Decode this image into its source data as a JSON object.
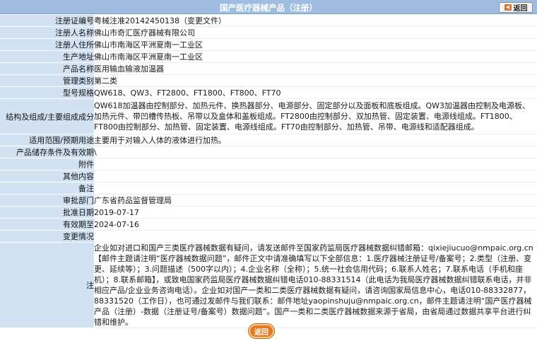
{
  "header": {
    "title": "国产医疗器械产品（注册）",
    "back_label": "返回"
  },
  "rows": [
    {
      "label": "注册证编号",
      "value": "粤械注准20142450138（变更文件）"
    },
    {
      "label": "注册人名称",
      "value": "佛山市奇汇医疗器械有限公司"
    },
    {
      "label": "注册人住所",
      "value": "佛山市南海区平洲夏南一工业区"
    },
    {
      "label": "生产地址",
      "value": "佛山市南海区平洲夏南一工业区"
    },
    {
      "label": "产品名称",
      "value": "医用输血输液加温器"
    },
    {
      "label": "管理类别",
      "value": "第二类"
    },
    {
      "label": "型号规格",
      "value": "QW618、QW3、FT2800、FT1800、FT800、FT70"
    },
    {
      "label": "结构及组成/主要组成成分",
      "value": "QW618加温器由控制部分、加热元件、换热器部分、电源部分、固定部分以及面板和底板组成。QW3加温器由控制及电源板、加热元件、带凹槽传热板、吊带以及盒体和盖板组成。FT2800由控制部分、双加热管、固定装置、电源线组成。FT1800、FT800由控制部分、加热管、固定装置、电源线组成。FT70由控制部分、加热管、吊带、电源线和适配器组成。"
    },
    {
      "label": "适用范围/预期用途",
      "value": "主要用于对输入人体的液体进行加热。"
    },
    {
      "label": "产品储存条件及有效期",
      "value": "\\"
    },
    {
      "label": "附件",
      "value": ""
    },
    {
      "label": "其他内容",
      "value": ""
    },
    {
      "label": "备注",
      "value": ""
    },
    {
      "label": "审批部门",
      "value": "广东省药品监督管理局"
    },
    {
      "label": "批准日期",
      "value": "2019-07-17"
    },
    {
      "label": "有效期至",
      "value": "2024-07-16"
    },
    {
      "label": "变更情况",
      "value": ""
    }
  ],
  "note": {
    "label": "注",
    "text": "企业如对进口和国产三类医疗器械数据有疑问，请发送邮件至国家药监局医疗器械数据纠错邮箱：qixiejiucuo@nmpaic.org.cn【邮件主题请注明“医疗器械数据问题”，邮件正文中请准确填写以下全部信息：1.医疗器械注册证号/备案号；2.类型（注册、变更、延续等）；3.问题描述（500字以内）；4.企业名称（全称）；5.统一社会信用代码；6.联系人姓名；7.联系电话（手机和座机）；8.联系邮箱】，或致电国家药监局医疗器械数据纠错电话010-88331514（此电话为我局医疗器械数据纠错联系电话，并非相应产品/企业业务咨询电话）。企业如对国产一类和二类医疗器械数据有疑问，请咨询国家局信息中心，电话010-88332877，88331520（工作日），也可通过发邮件与我们联系：邮件地址yaopinshuju@nmpaic.org.cn，邮件主题请注明“国产医疗器械产品（注册）-数据（注册证号/备案号）数据问题”。国产一类和二类医疗器械数据来源于省局，由省局通过数据共享平台进行纠错和维护。"
  },
  "footer": {
    "back_label": "返回"
  }
}
